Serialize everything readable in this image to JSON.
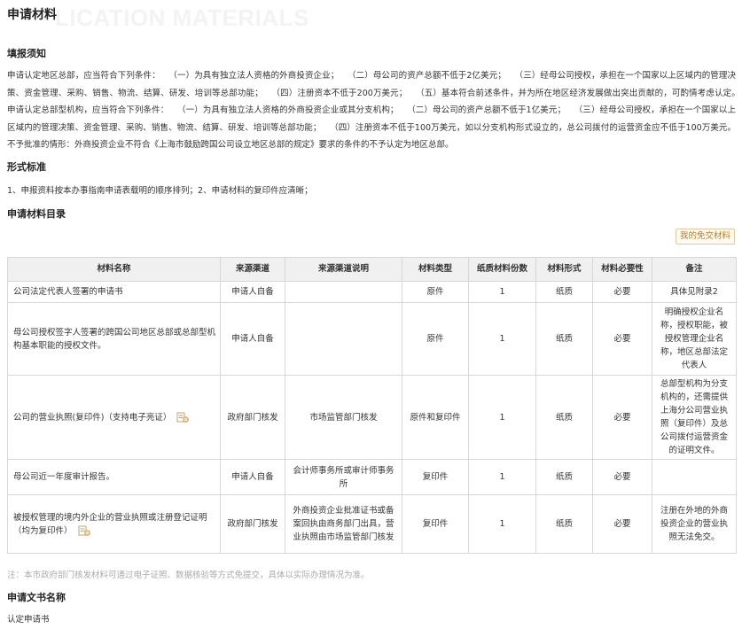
{
  "page": {
    "watermark": "LICATION MATERIALS",
    "title": "申请材料"
  },
  "section_instructions": {
    "title": "填报须知",
    "text": "申请认定地区总部，应当符合下列条件：　　（一）为具有独立法人资格的外商投资企业；　　（二）母公司的资产总额不低于2亿美元；　　（三）经母公司授权，承担在一个国家以上区域内的管理决策、资金管理、采购、销售、物流、结算、研发、培训等总部功能；　　（四）注册资本不低于200万美元；　　（五）基本符合前述条件，并为所在地区经济发展做出突出贡献的，可酌情考虑认定。　　申请认定总部型机构，应当符合下列条件：　　（一）为具有独立法人资格的外商投资企业或其分支机构；　　（二）母公司的资产总额不低于1亿美元；　　（三）经母公司授权，承担在一个国家以上区域内的管理决策、资金管理、采购、销售、物流、结算、研发、培训等总部功能；　　（四）注册资本不低于100万美元，如以分支机构形式设立的，总公司拨付的运营资金应不低于100万美元。 不予批准的情形：外商投资企业不符合《上海市鼓励跨国公司设立地区总部的规定》要求的条件的不予认定为地区总部。"
  },
  "section_format": {
    "title": "形式标准",
    "text": "1、申报资料按本办事指南申请表载明的顺序排列；2、申请材料的复印件应清晰；"
  },
  "section_catalog": {
    "title": "申请材料目录",
    "free_button": "我的免交材料"
  },
  "table": {
    "headers": [
      "材料名称",
      "来源渠道",
      "来源渠道说明",
      "材料类型",
      "纸质材料份数",
      "材料形式",
      "材料必要性",
      "备注"
    ],
    "rows": [
      {
        "name": "公司法定代表人签署的申请书",
        "source": "申请人自备",
        "source_desc": "",
        "type": "原件",
        "count": "1",
        "form": "纸质",
        "required": "必要",
        "note": "具体见附录2"
      },
      {
        "name": "母公司授权签字人签署的跨国公司地区总部或总部型机构基本职能的授权文件。",
        "source": "申请人自备",
        "source_desc": "",
        "type": "原件",
        "count": "1",
        "form": "纸质",
        "required": "必要",
        "note": "明确授权企业名称，授权职能，被授权管理企业名称，地区总部法定代表人"
      },
      {
        "name": "公司的营业执照(复印件)（支持电子亮证）",
        "source": "政府部门核发",
        "source_desc": "市场监管部门核发",
        "type": "原件和复印件",
        "count": "1",
        "form": "纸质",
        "required": "必要",
        "note": "总部型机构为分支机构的，还需提供上海分公司营业执照（复印件）及总公司拨付运营资金的证明文件。"
      },
      {
        "name": "母公司近一年度审计报告。",
        "source": "申请人自备",
        "source_desc": "会计师事务所或审计师事务所",
        "type": "复印件",
        "count": "1",
        "form": "纸质",
        "required": "必要",
        "note": ""
      },
      {
        "name": "被授权管理的境内外企业的营业执照或注册登记证明（均为复印件）",
        "source": "政府部门核发",
        "source_desc": "外商投资企业批准证书或备案回执由商务部门出具，营业执照由市场监管部门核发",
        "type": "复印件",
        "count": "1",
        "form": "纸质",
        "required": "必要",
        "note": "注册在外地的外商投资企业的营业执照无法免交。"
      }
    ]
  },
  "footnote": "注：本市政府部门核发材料可通过电子证照、数据核验等方式免提交，具体以实际办理情况为准。",
  "section_docname": {
    "title": "申请文书名称",
    "value": "认定申请书"
  },
  "icons": {
    "doc": "document-icon",
    "accent": "#c9a066"
  }
}
